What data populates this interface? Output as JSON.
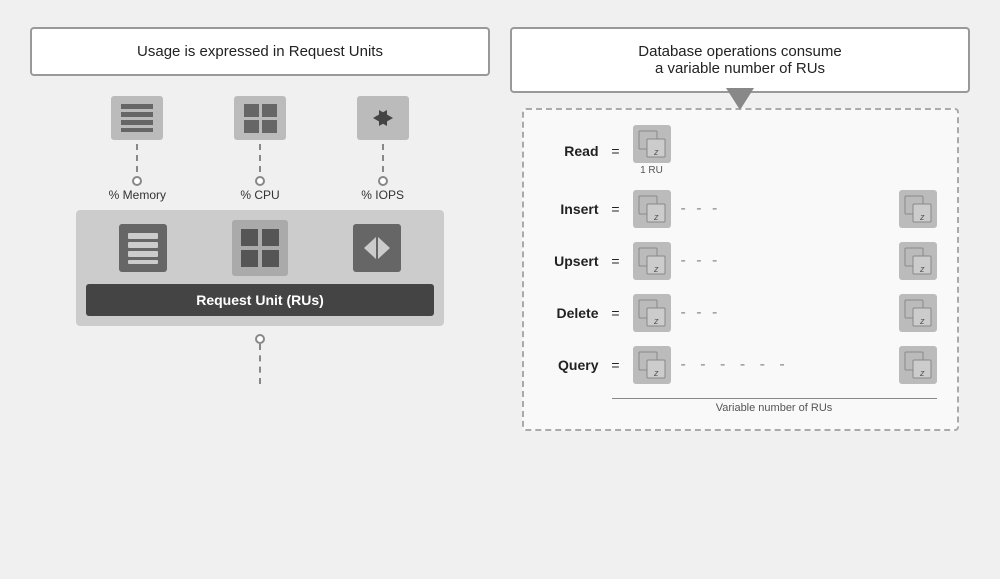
{
  "left": {
    "title": "Usage is expressed in Request Units",
    "icons": [
      {
        "label": "% Memory",
        "type": "lines"
      },
      {
        "label": "% CPU",
        "type": "grid"
      },
      {
        "label": "% IOPS",
        "type": "arrows"
      }
    ],
    "ru_label": "Request Unit (RUs)"
  },
  "right": {
    "title": "Database operations consume\na variable number of RUs",
    "operations": [
      {
        "name": "Read",
        "show_right": false,
        "show_dashes": false,
        "ru_label": "1 RU"
      },
      {
        "name": "Insert",
        "show_right": true,
        "show_dashes": true
      },
      {
        "name": "Upsert",
        "show_right": true,
        "show_dashes": true
      },
      {
        "name": "Delete",
        "show_right": true,
        "show_dashes": true
      },
      {
        "name": "Query",
        "show_right": true,
        "show_dashes": true,
        "long_dashes": true
      }
    ],
    "variable_label": "Variable number of RUs"
  }
}
